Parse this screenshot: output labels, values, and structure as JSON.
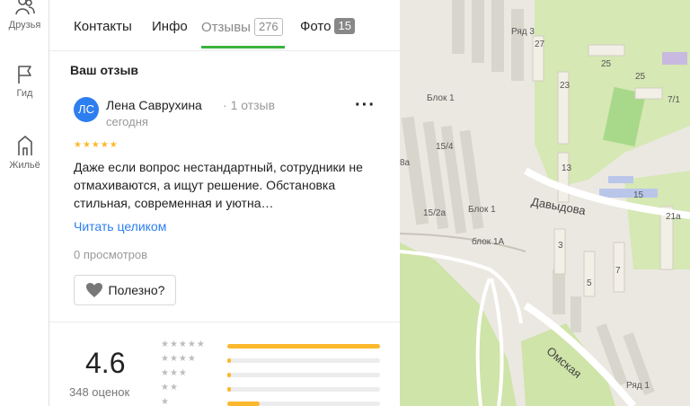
{
  "rail": {
    "friends_label": "Друзья",
    "guide_label": "Гид",
    "housing_label": "Жильё"
  },
  "tabs": [
    {
      "label": "Контакты"
    },
    {
      "label": "Инфо"
    },
    {
      "label": "Отзывы",
      "badge": "276"
    },
    {
      "label": "Фото",
      "badge": "15"
    }
  ],
  "review": {
    "section_title": "Ваш отзыв",
    "avatar_initials": "ЛС",
    "author_name": "Лена Саврухина",
    "author_reviews": "1 отзыв",
    "date": "сегодня",
    "rating": 5,
    "stars": "★★★★★",
    "text": "Даже если вопрос нестандартный, сотрудники не отмахиваются, а ищут решение. Обстановка стильная, современная и уютна…",
    "read_more": "Читать целиком",
    "views": "0 просмотров",
    "useful_label": "Полезно?"
  },
  "summary": {
    "rating": "4.6",
    "count": "348 оценок",
    "distribution": [
      {
        "stars": "★★★★★",
        "fraction": 1.0
      },
      {
        "stars": "★★★★",
        "fraction": 0.02
      },
      {
        "stars": "★★★",
        "fraction": 0.02
      },
      {
        "stars": "★★",
        "fraction": 0.02
      },
      {
        "stars": "★",
        "fraction": 0.21
      }
    ]
  },
  "map": {
    "labels": [
      "Ряд 3",
      "27",
      "25",
      "23",
      "25",
      "7/1",
      "Блок 1",
      "15/4",
      "8а",
      "13",
      "15",
      "21а",
      "15/2а",
      "Блок 1",
      "блок 1А",
      "3",
      "5",
      "7",
      "Ряд 1"
    ],
    "streets": [
      "Давыдова",
      "Омская"
    ]
  },
  "colors": {
    "accent_green": "#3bb33b",
    "link_blue": "#2d7ef0",
    "star_yellow": "#fcb82d"
  }
}
